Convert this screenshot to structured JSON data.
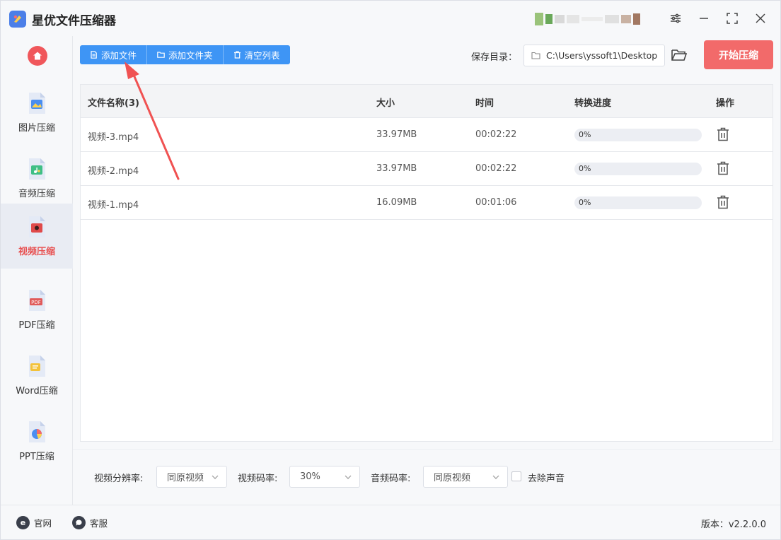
{
  "app": {
    "title": "星优文件压缩器"
  },
  "sidebar": {
    "items": [
      {
        "label": "图片压缩",
        "icon": "image-icon"
      },
      {
        "label": "音频压缩",
        "icon": "audio-icon"
      },
      {
        "label": "视频压缩",
        "icon": "video-icon",
        "active": true
      },
      {
        "label": "PDF压缩",
        "icon": "pdf-icon"
      },
      {
        "label": "Word压缩",
        "icon": "word-icon"
      },
      {
        "label": "PPT压缩",
        "icon": "ppt-icon"
      }
    ]
  },
  "toolbar": {
    "add_file": "添加文件",
    "add_folder": "添加文件夹",
    "clear_list": "清空列表",
    "save_dir_label": "保存目录：",
    "save_dir_value": "C:\\Users\\yssoft1\\Desktop",
    "start": "开始压缩"
  },
  "table": {
    "headers": {
      "name": "文件名称(3)",
      "size": "大小",
      "time": "时间",
      "progress": "转换进度",
      "action": "操作"
    },
    "rows": [
      {
        "name": "视频-3.mp4",
        "size": "33.97MB",
        "time": "00:02:22",
        "progress": "0%"
      },
      {
        "name": "视频-2.mp4",
        "size": "33.97MB",
        "time": "00:02:22",
        "progress": "0%"
      },
      {
        "name": "视频-1.mp4",
        "size": "16.09MB",
        "time": "00:01:06",
        "progress": "0%"
      }
    ]
  },
  "settings": {
    "resolution_label": "视频分辨率:",
    "resolution_value": "同原视频",
    "video_bitrate_label": "视频码率:",
    "video_bitrate_value": "30%",
    "audio_bitrate_label": "音频码率:",
    "audio_bitrate_value": "同原视频",
    "remove_audio_label": "去除声音"
  },
  "footer": {
    "website": "官网",
    "support": "客服",
    "version": "版本：v2.2.0.0"
  },
  "colors": {
    "accent_blue": "#3e95f5",
    "start_red": "#f26a6a",
    "active_red": "#e85050"
  }
}
